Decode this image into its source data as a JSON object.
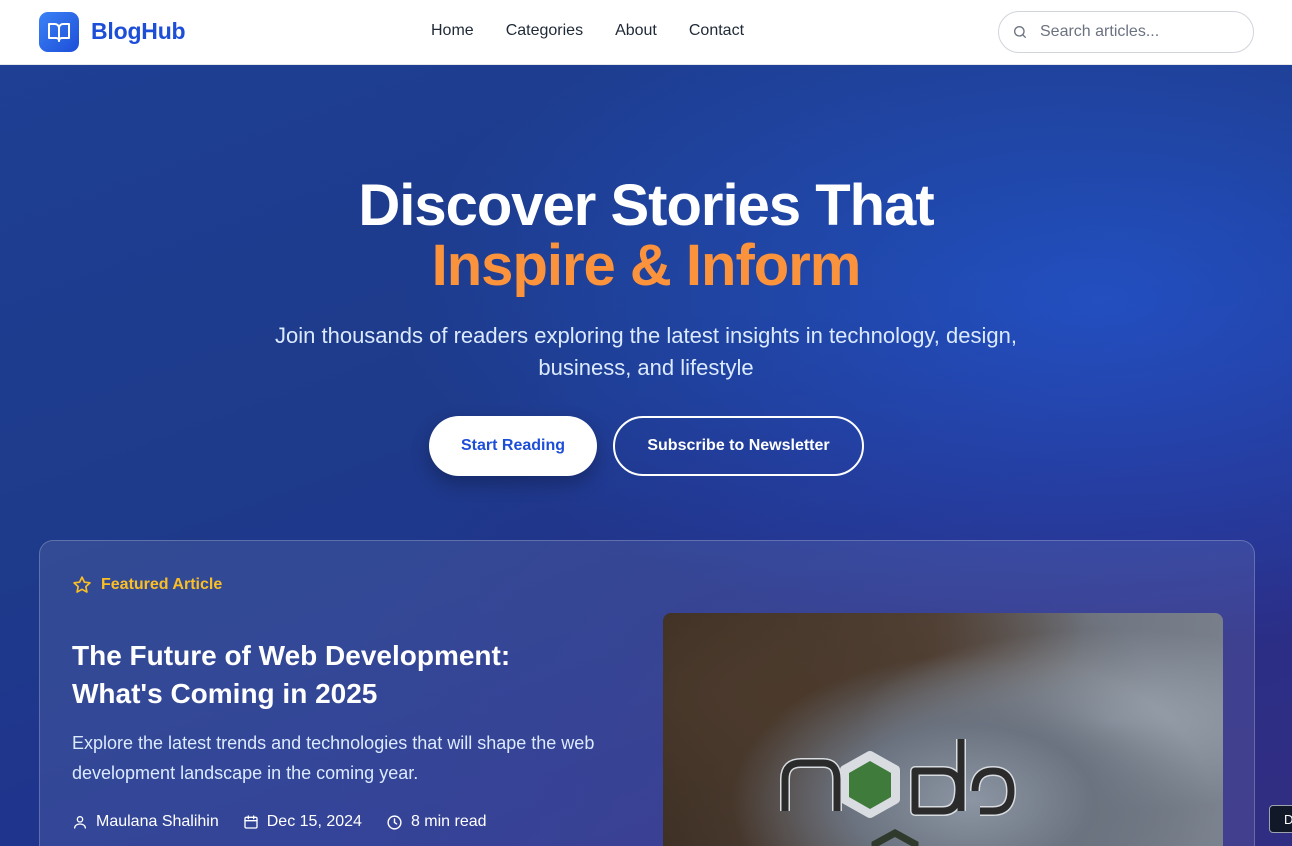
{
  "header": {
    "brand": "BlogHub",
    "nav": [
      "Home",
      "Categories",
      "About",
      "Contact"
    ],
    "search_placeholder": "Search articles..."
  },
  "hero": {
    "title_line1": "Discover Stories That",
    "title_line2": "Inspire & Inform",
    "subtitle": "Join thousands of readers exploring the latest insights in technology, design, business, and lifestyle",
    "primary_button": "Start Reading",
    "secondary_button": "Subscribe to Newsletter"
  },
  "featured": {
    "label": "Featured Article",
    "title": "The Future of Web Development: What's Coming in 2025",
    "description": "Explore the latest trends and technologies that will shape the web development landscape in the coming year.",
    "author": "Maulana Shalihin",
    "date": "Dec 15, 2024",
    "read_time": "8 min read"
  },
  "corner_badge": "D",
  "colors": {
    "brand": "#1d4ed8",
    "accent": "#fb923c",
    "featured_label": "#fbbf24",
    "hero_bg": "#1e3a8a"
  },
  "icons": [
    "book-open-icon",
    "search-icon",
    "star-icon",
    "user-icon",
    "calendar-icon",
    "clock-icon"
  ]
}
